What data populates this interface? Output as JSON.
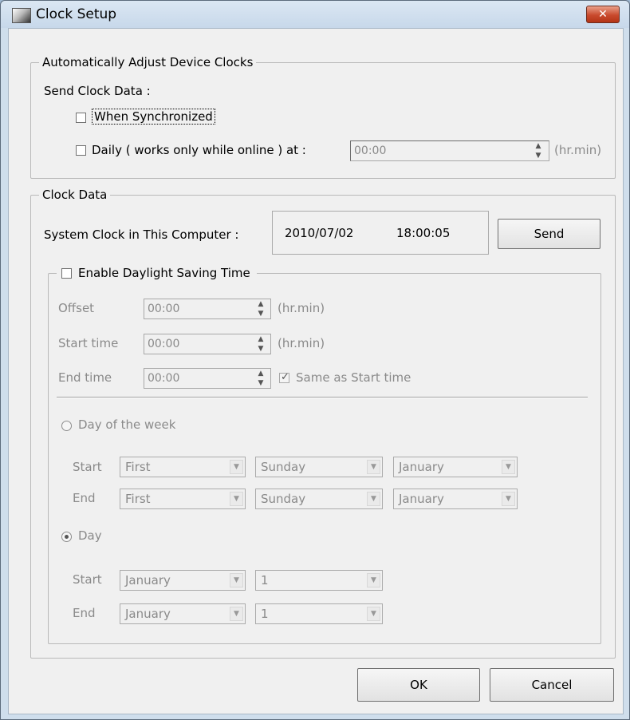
{
  "window": {
    "title": "Clock Setup",
    "close_glyph": "✕"
  },
  "auto_adjust": {
    "legend": "Automatically Adjust Device Clocks",
    "send_label": "Send Clock Data :",
    "when_sync_label": "When Synchronized",
    "when_sync_checked": false,
    "daily_label": "Daily ( works only while online ) at :",
    "daily_checked": false,
    "daily_time": "00:00",
    "daily_unit": "(hr.min)"
  },
  "clock_data": {
    "legend": "Clock Data",
    "system_clock_label": "System Clock in This Computer :",
    "date": "2010/07/02",
    "time": "18:00:05",
    "send_button": "Send"
  },
  "dst": {
    "enable_label": "Enable Daylight Saving Time",
    "enabled": false,
    "offset_label": "Offset",
    "offset_value": "00:00",
    "offset_unit": "(hr.min)",
    "start_time_label": "Start time",
    "start_time_value": "00:00",
    "start_time_unit": "(hr.min)",
    "end_time_label": "End time",
    "end_time_value": "00:00",
    "same_as_start_label": "Same as Start time",
    "same_as_start_checked": true,
    "day_of_week_label": "Day of the week",
    "day_label": "Day",
    "selected_mode": "Day",
    "start_label": "Start",
    "end_label": "End",
    "dow_start": {
      "week": "First",
      "weekday": "Sunday",
      "month": "January"
    },
    "dow_end": {
      "week": "First",
      "weekday": "Sunday",
      "month": "January"
    },
    "day_start": {
      "month": "January",
      "day": "1"
    },
    "day_end": {
      "month": "January",
      "day": "1"
    }
  },
  "buttons": {
    "ok": "OK",
    "cancel": "Cancel"
  },
  "icons": {
    "title": "clock-setup-app-icon",
    "close": "close-icon",
    "spin": "spin-arrows-icon",
    "dropdown": "dropdown-arrow-icon"
  },
  "colors": {
    "window_frame": "#cfdeec",
    "close_button": "#c94a2e",
    "client_bg": "#f0f0f0",
    "disabled_text": "#8a8a8a"
  }
}
